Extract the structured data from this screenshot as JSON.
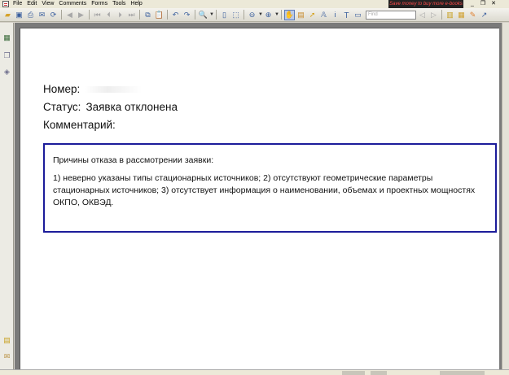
{
  "menubar": {
    "items": [
      {
        "label": "File",
        "key": "F"
      },
      {
        "label": "Edit",
        "key": "E"
      },
      {
        "label": "View",
        "key": "V"
      },
      {
        "label": "Comments",
        "key": "C"
      },
      {
        "label": "Forms",
        "key": "o"
      },
      {
        "label": "Tools",
        "key": "T"
      },
      {
        "label": "Help",
        "key": "H"
      }
    ],
    "promo": "Save money to buy more e-books"
  },
  "toolbar": {
    "find_placeholder": "Find"
  },
  "document": {
    "number_label": "Номер:",
    "status_label": "Статус:",
    "status_value": "Заявка отклонена",
    "comment_label": "Комментарий:",
    "comment_heading": "Причины отказа в рассмотрении заявки:",
    "comment_text": "1) неверно указаны типы стационарных источников; 2) отсутствуют геометрические параметры стационарных источников; 3) отсутствует информация о наименовании, объемах и проектных мощностях ОКПО, ОКВЭД."
  },
  "colors": {
    "comment_border": "#1c1c9a",
    "promo_text": "#ff4a4a"
  }
}
